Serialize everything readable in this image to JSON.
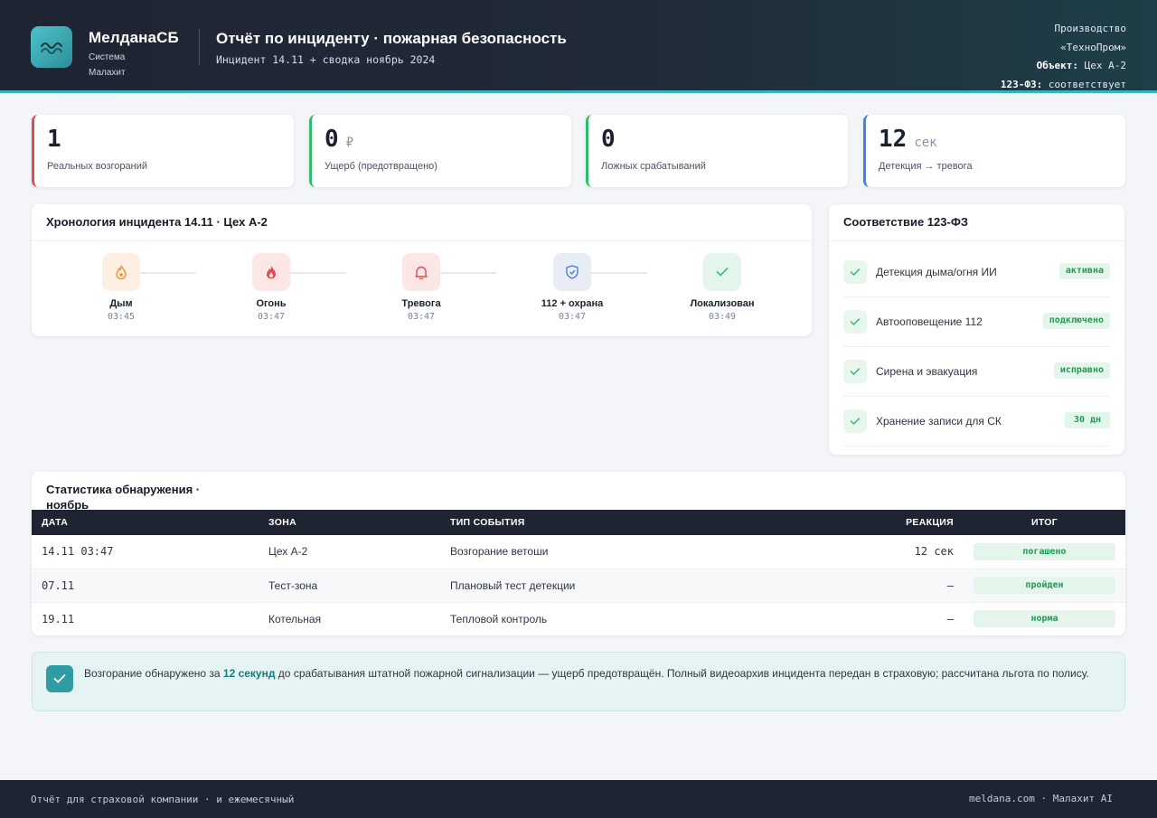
{
  "header": {
    "brand_name": "МелданаСБ",
    "brand_sub": "Система Малахит",
    "title": "Отчёт по инциденту · пожарная безопасность",
    "subtitle": "Инцидент 14.11 + сводка ноябрь 2024",
    "right_line1": "Производство",
    "right_line2": "«ТехноПром»",
    "object_label": "Объект:",
    "object_value": "Цех А-2",
    "law_label": "123-ФЗ:",
    "law_value": "соответствует"
  },
  "kpis": [
    {
      "value": "1",
      "unit": "",
      "label": "Реальных возгораний",
      "color": "#e04b4b"
    },
    {
      "value": "0",
      "unit": "₽",
      "label": "Ущерб (предотвращено)",
      "color": "#2fbf6a"
    },
    {
      "value": "0",
      "unit": "",
      "label": "Ложных срабатываний",
      "color": "#2fbf6a"
    },
    {
      "value": "12",
      "unit": "сек",
      "label": "Детекция → тревога",
      "color": "#3b82f6"
    }
  ],
  "timeline": {
    "title": "Хронология инцидента 14.11 · Цех А-2",
    "steps": [
      {
        "name": "Дым",
        "time": "03:45",
        "icon": "flame-outline-icon"
      },
      {
        "name": "Огонь",
        "time": "03:47",
        "icon": "fire-icon"
      },
      {
        "name": "Тревога",
        "time": "03:47",
        "icon": "bell-icon"
      },
      {
        "name": "112 + охрана",
        "time": "03:47",
        "icon": "shield-icon"
      },
      {
        "name": "Локализован",
        "time": "03:49",
        "icon": "check-icon"
      }
    ]
  },
  "compliance": {
    "title": "Соответствие 123-ФЗ",
    "items": [
      {
        "label": "Детекция дыма/огня ИИ",
        "status": "активна"
      },
      {
        "label": "Автооповещение 112",
        "status": "подключено"
      },
      {
        "label": "Сирена и эвакуация",
        "status": "исправно"
      },
      {
        "label": "Хранение записи для СК",
        "status": "30 дн"
      }
    ]
  },
  "stats": {
    "title": "Статистика обнаружения · ноябрь",
    "columns": [
      "ДАТА",
      "ЗОНА",
      "ТИП СОБЫТИЯ",
      "РЕАКЦИЯ",
      "ИТОГ"
    ],
    "rows": [
      {
        "date": "14.11 03:47",
        "zone": "Цех А-2",
        "type": "Возгорание ветоши",
        "reaction": "12 сек",
        "result": "погашено"
      },
      {
        "date": "07.11",
        "zone": "Тест-зона",
        "type": "Плановый тест детекции",
        "reaction": "—",
        "result": "пройден"
      },
      {
        "date": "19.11",
        "zone": "Котельная",
        "type": "Тепловой контроль",
        "reaction": "—",
        "result": "норма"
      }
    ]
  },
  "note": {
    "before": "Возгорание обнаружено за ",
    "highlight": "12 секунд",
    "after": " до срабатывания штатной пожарной сигнализации — ущерб предотвращён. Полный видеоархив инцидента передан в страховую; рассчитана льгота по полису."
  },
  "footer": {
    "left": "Отчёт для страховой компании · и ежемесячный",
    "right": "meldana.com · Малахит AI"
  }
}
